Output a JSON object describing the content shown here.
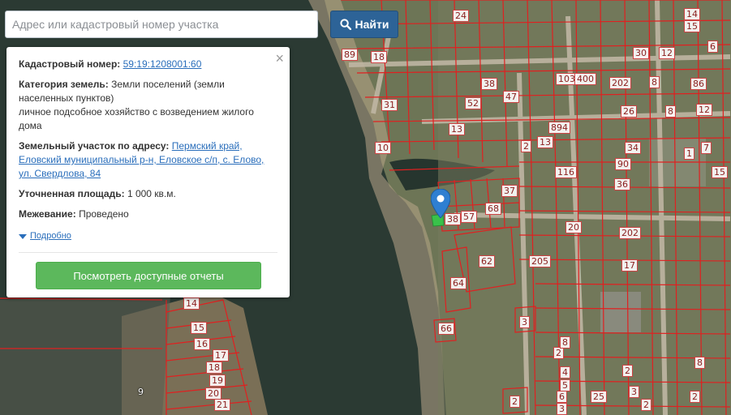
{
  "search": {
    "placeholder": "Адрес или кадастровый номер участка",
    "button_label": "Найти",
    "button_icon": "search-icon"
  },
  "info_panel": {
    "close_glyph": "×",
    "cadastral_label": "Кадастровый номер:",
    "cadastral_value": "59:19:1208001:60",
    "category_label": "Категория земель:",
    "category_value": "Земли поселений (земли населенных пунктов)",
    "category_use": "личное подсобное хозяйство с возведением жилого дома",
    "address_label": "Земельный участок по адресу:",
    "address_value": "Пермский край, Еловский муниципальный р-н, Еловское с/п, с. Елово, ул. Свердлова, 84",
    "area_label": "Уточненная площадь:",
    "area_value": "1 000 кв.м.",
    "survey_label": "Межевание:",
    "survey_value": "Проведено",
    "details_link": "Подробно",
    "report_button": "Посмотреть доступные отчеты"
  },
  "map": {
    "colors": {
      "water": "#2b3a33",
      "land": "#6d7556",
      "sand": "#b9a58a",
      "field": "#7a6f56",
      "parcel_border": "#e02020",
      "marker": "#2f7fd1",
      "selected_parcel": "#39c24a"
    },
    "plot_labels": [
      "24",
      "14",
      "15",
      "89",
      "18",
      "30",
      "12",
      "6",
      "103",
      "400",
      "202",
      "8",
      "86",
      "38",
      "52",
      "47",
      "31",
      "13",
      "8",
      "26",
      "12",
      "2",
      "10",
      "34",
      "7",
      "90",
      "15",
      "13",
      "894",
      "116",
      "1",
      "37",
      "68",
      "38",
      "57",
      "20",
      "36",
      "202",
      "62",
      "205",
      "17",
      "64",
      "66",
      "3",
      "2",
      "8",
      "4",
      "5",
      "6",
      "3",
      "25",
      "2",
      "3",
      "2",
      "2",
      "2",
      "8",
      "14",
      "15",
      "16",
      "17",
      "18",
      "19",
      "20",
      "21",
      "9"
    ]
  }
}
